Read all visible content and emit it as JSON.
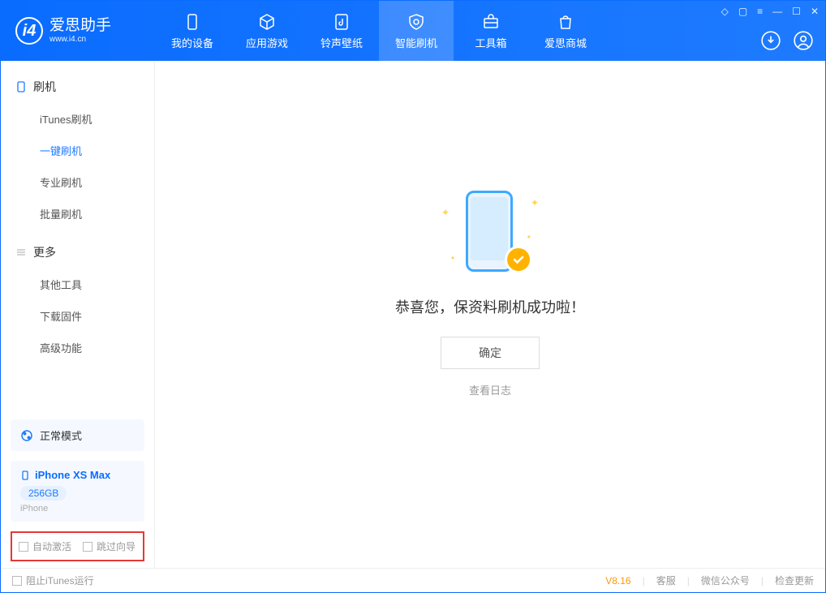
{
  "app": {
    "name_cn": "爱思助手",
    "name_en": "www.i4.cn"
  },
  "header_tabs": [
    {
      "label": "我的设备"
    },
    {
      "label": "应用游戏"
    },
    {
      "label": "铃声壁纸"
    },
    {
      "label": "智能刷机"
    },
    {
      "label": "工具箱"
    },
    {
      "label": "爱思商城"
    }
  ],
  "sidebar": {
    "section1": {
      "title": "刷机",
      "items": [
        "iTunes刷机",
        "一键刷机",
        "专业刷机",
        "批量刷机"
      ]
    },
    "section2": {
      "title": "更多",
      "items": [
        "其他工具",
        "下载固件",
        "高级功能"
      ]
    },
    "mode_card": "正常模式",
    "device": {
      "name": "iPhone XS Max",
      "storage": "256GB",
      "type": "iPhone"
    },
    "checkboxes": {
      "auto_activate": "自动激活",
      "skip_guide": "跳过向导"
    }
  },
  "main": {
    "success_msg": "恭喜您，保资料刷机成功啦！",
    "ok_button": "确定",
    "view_log": "查看日志"
  },
  "footer": {
    "block_itunes": "阻止iTunes运行",
    "version": "V8.16",
    "links": [
      "客服",
      "微信公众号",
      "检查更新"
    ]
  }
}
